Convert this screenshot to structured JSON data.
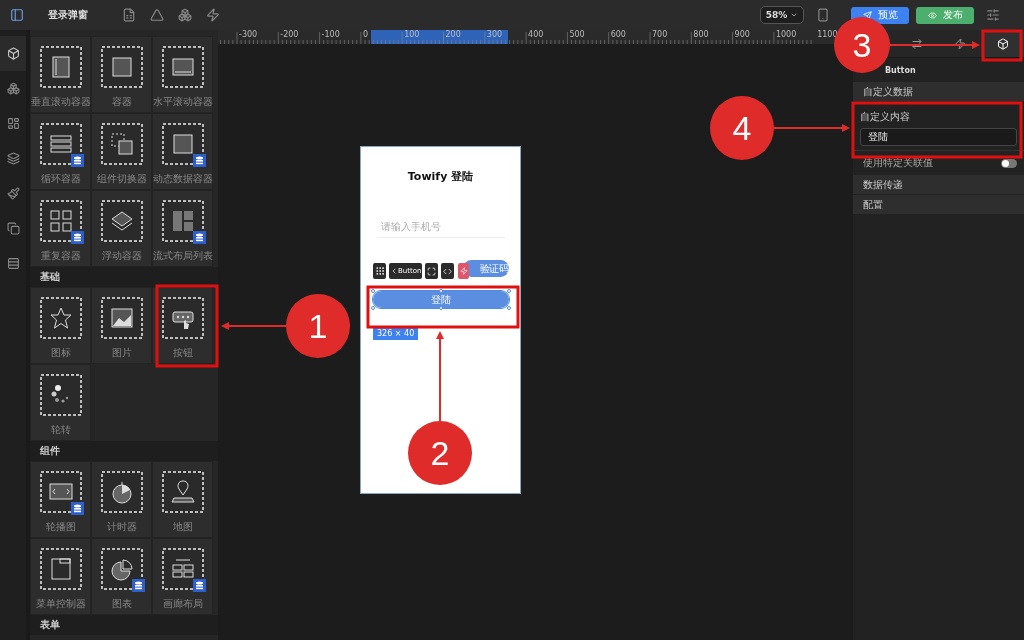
{
  "topbar": {
    "title": "登录弹窗",
    "zoom": "58%",
    "preview_button": "预览",
    "publish_button": "发布"
  },
  "rail": [
    {
      "selected": true
    },
    {
      "selected": false
    },
    {
      "selected": false
    },
    {
      "selected": false
    },
    {
      "selected": false
    },
    {
      "selected": false
    },
    {
      "selected": false
    }
  ],
  "ruler": {
    "labels": [
      "-300",
      "-200",
      "-100",
      "0",
      "100",
      "200",
      "300",
      "400",
      "500",
      "600",
      "700",
      "800",
      "900",
      "1000",
      "1100"
    ]
  },
  "component_panel": {
    "sections": [
      {
        "items": [
          {
            "label": "垂直滚动容器",
            "data_badge": false
          },
          {
            "label": "容器",
            "data_badge": false
          },
          {
            "label": "水平滚动容器",
            "data_badge": false
          },
          {
            "label": "循环容器",
            "data_badge": true
          },
          {
            "label": "组件切换器",
            "data_badge": false
          },
          {
            "label": "动态数据容器",
            "data_badge": true
          },
          {
            "label": "重复容器",
            "data_badge": true
          },
          {
            "label": "浮动容器",
            "data_badge": false
          },
          {
            "label": "流式布局列表",
            "data_badge": true
          }
        ]
      },
      {
        "title": "基础",
        "items": [
          {
            "label": "图标",
            "data_badge": false
          },
          {
            "label": "图片",
            "data_badge": false
          },
          {
            "label": "按钮",
            "data_badge": false
          },
          {
            "label": "轮转",
            "data_badge": false
          }
        ]
      },
      {
        "title": "组件",
        "items": [
          {
            "label": "轮播图",
            "data_badge": true
          },
          {
            "label": "计时器",
            "data_badge": false
          },
          {
            "label": "地图",
            "data_badge": false
          },
          {
            "label": "菜单控制器",
            "data_badge": false
          },
          {
            "label": "图表",
            "data_badge": true
          },
          {
            "label": "画廊布局",
            "data_badge": true
          }
        ]
      },
      {
        "title": "表单"
      }
    ]
  },
  "canvas": {
    "phone": {
      "title": "Towify 登陆",
      "phone_placeholder": "请输入手机号",
      "code_button": "验证码",
      "login_button": "登陆",
      "size_label": "326 × 40"
    },
    "toolbar": {
      "label": "Button"
    }
  },
  "inspector": {
    "tabs": [
      {
        "selected": false
      },
      {
        "selected": false
      },
      {
        "selected": true
      }
    ],
    "component_name": "Button",
    "section_header": "自定义数据",
    "field_label": "自定义内容",
    "field_value": "登陆",
    "toggle": {
      "label": "使用特定关联值",
      "on": false
    },
    "rows": [
      "数据传递",
      "配置"
    ]
  },
  "annotations": [
    {
      "label": "1"
    },
    {
      "label": "2"
    },
    {
      "label": "3"
    },
    {
      "label": "4"
    }
  ]
}
